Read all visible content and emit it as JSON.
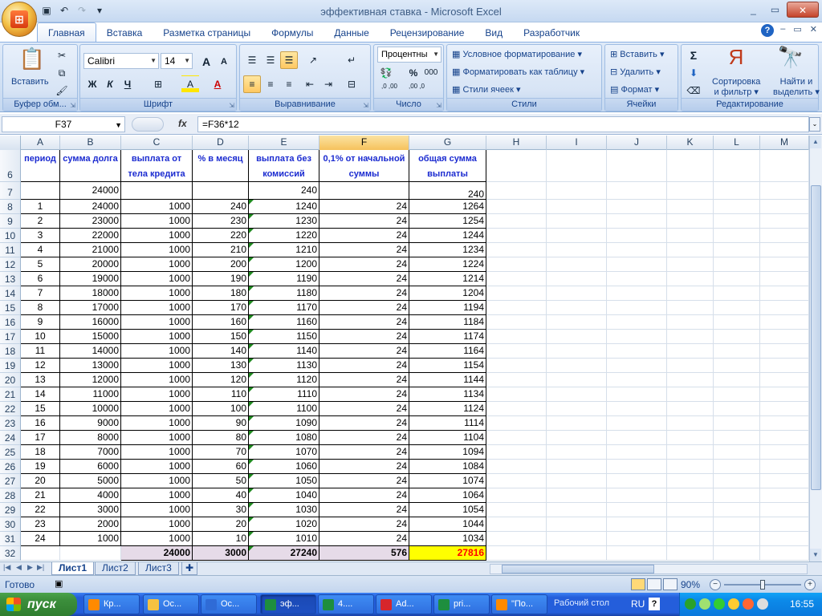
{
  "window": {
    "title": "эффективная ставка - Microsoft Excel",
    "controls": [
      "_",
      "▭",
      "✕"
    ]
  },
  "qat": {
    "icons": [
      "save-icon",
      "undo-icon",
      "redo-icon",
      "customize-icon"
    ]
  },
  "tabs": [
    "Главная",
    "Вставка",
    "Разметка страницы",
    "Формулы",
    "Данные",
    "Рецензирование",
    "Вид",
    "Разработчик"
  ],
  "active_tab": "Главная",
  "ribbon": {
    "clipboard": {
      "label": "Буфер обм...",
      "paste": "Вставить"
    },
    "font": {
      "label": "Шрифт",
      "name": "Calibri",
      "size": "14",
      "bold": "Ж",
      "italic": "К",
      "underline": "Ч",
      "grow": "A",
      "shrink": "A",
      "fill": "A",
      "color": "A"
    },
    "alignment": {
      "label": "Выравнивание"
    },
    "number": {
      "label": "Число",
      "format": "Процентны",
      "percent": "%",
      "thousands": "000",
      "inc": ",0 ,00",
      "dec": ",00 ,0"
    },
    "styles": {
      "label": "Стили",
      "conditional": "Условное форматирование",
      "table": "Форматировать как таблицу",
      "cell": "Стили ячеек"
    },
    "cells": {
      "label": "Ячейки",
      "insert": "Вставить",
      "delete": "Удалить",
      "format": "Формат"
    },
    "editing": {
      "label": "Редактирование",
      "sigma": "Σ",
      "sort1": "Сортировка",
      "sort2": "и фильтр",
      "find1": "Найти и",
      "find2": "выделить"
    }
  },
  "formula_bar": {
    "name_box": "F37",
    "fx": "fx",
    "formula": "=F36*12"
  },
  "columns": [
    "A",
    "B",
    "C",
    "D",
    "E",
    "F",
    "G",
    "H",
    "I",
    "J",
    "K",
    "L",
    "M"
  ],
  "selected_column": "F",
  "header_row": {
    "row": "6",
    "A": "период",
    "B": "сумма долга",
    "C": "выплата от тела кредита",
    "D": "% в месяц",
    "E": "выплата без комиссий",
    "F": "0,1% от начальной суммы",
    "G": "общая сумма выплаты"
  },
  "row7": {
    "row": "7",
    "B": "24000",
    "E": "240",
    "G": "240"
  },
  "data_rows": [
    {
      "row": "8",
      "A": "1",
      "B": "24000",
      "C": "1000",
      "D": "240",
      "E": "1240",
      "F": "24",
      "G": "1264"
    },
    {
      "row": "9",
      "A": "2",
      "B": "23000",
      "C": "1000",
      "D": "230",
      "E": "1230",
      "F": "24",
      "G": "1254"
    },
    {
      "row": "10",
      "A": "3",
      "B": "22000",
      "C": "1000",
      "D": "220",
      "E": "1220",
      "F": "24",
      "G": "1244"
    },
    {
      "row": "11",
      "A": "4",
      "B": "21000",
      "C": "1000",
      "D": "210",
      "E": "1210",
      "F": "24",
      "G": "1234"
    },
    {
      "row": "12",
      "A": "5",
      "B": "20000",
      "C": "1000",
      "D": "200",
      "E": "1200",
      "F": "24",
      "G": "1224"
    },
    {
      "row": "13",
      "A": "6",
      "B": "19000",
      "C": "1000",
      "D": "190",
      "E": "1190",
      "F": "24",
      "G": "1214"
    },
    {
      "row": "14",
      "A": "7",
      "B": "18000",
      "C": "1000",
      "D": "180",
      "E": "1180",
      "F": "24",
      "G": "1204"
    },
    {
      "row": "15",
      "A": "8",
      "B": "17000",
      "C": "1000",
      "D": "170",
      "E": "1170",
      "F": "24",
      "G": "1194"
    },
    {
      "row": "16",
      "A": "9",
      "B": "16000",
      "C": "1000",
      "D": "160",
      "E": "1160",
      "F": "24",
      "G": "1184"
    },
    {
      "row": "17",
      "A": "10",
      "B": "15000",
      "C": "1000",
      "D": "150",
      "E": "1150",
      "F": "24",
      "G": "1174"
    },
    {
      "row": "18",
      "A": "11",
      "B": "14000",
      "C": "1000",
      "D": "140",
      "E": "1140",
      "F": "24",
      "G": "1164"
    },
    {
      "row": "19",
      "A": "12",
      "B": "13000",
      "C": "1000",
      "D": "130",
      "E": "1130",
      "F": "24",
      "G": "1154"
    },
    {
      "row": "20",
      "A": "13",
      "B": "12000",
      "C": "1000",
      "D": "120",
      "E": "1120",
      "F": "24",
      "G": "1144"
    },
    {
      "row": "21",
      "A": "14",
      "B": "11000",
      "C": "1000",
      "D": "110",
      "E": "1110",
      "F": "24",
      "G": "1134"
    },
    {
      "row": "22",
      "A": "15",
      "B": "10000",
      "C": "1000",
      "D": "100",
      "E": "1100",
      "F": "24",
      "G": "1124"
    },
    {
      "row": "23",
      "A": "16",
      "B": "9000",
      "C": "1000",
      "D": "90",
      "E": "1090",
      "F": "24",
      "G": "1114"
    },
    {
      "row": "24",
      "A": "17",
      "B": "8000",
      "C": "1000",
      "D": "80",
      "E": "1080",
      "F": "24",
      "G": "1104"
    },
    {
      "row": "25",
      "A": "18",
      "B": "7000",
      "C": "1000",
      "D": "70",
      "E": "1070",
      "F": "24",
      "G": "1094"
    },
    {
      "row": "26",
      "A": "19",
      "B": "6000",
      "C": "1000",
      "D": "60",
      "E": "1060",
      "F": "24",
      "G": "1084"
    },
    {
      "row": "27",
      "A": "20",
      "B": "5000",
      "C": "1000",
      "D": "50",
      "E": "1050",
      "F": "24",
      "G": "1074"
    },
    {
      "row": "28",
      "A": "21",
      "B": "4000",
      "C": "1000",
      "D": "40",
      "E": "1040",
      "F": "24",
      "G": "1064"
    },
    {
      "row": "29",
      "A": "22",
      "B": "3000",
      "C": "1000",
      "D": "30",
      "E": "1030",
      "F": "24",
      "G": "1054"
    },
    {
      "row": "30",
      "A": "23",
      "B": "2000",
      "C": "1000",
      "D": "20",
      "E": "1020",
      "F": "24",
      "G": "1044"
    },
    {
      "row": "31",
      "A": "24",
      "B": "1000",
      "C": "1000",
      "D": "10",
      "E": "1010",
      "F": "24",
      "G": "1034"
    }
  ],
  "totals_row": {
    "row": "32",
    "C": "24000",
    "D": "3000",
    "E": "27240",
    "F": "576",
    "G": "27816"
  },
  "sheets": [
    "Лист1",
    "Лист2",
    "Лист3"
  ],
  "active_sheet": "Лист1",
  "status": {
    "ready": "Готово",
    "zoom": "90%",
    "zoom_fraction": 0.5
  },
  "taskbar": {
    "start": "пуск",
    "tasks": [
      "Кр...",
      "Ос...",
      "Ос...",
      "эф...",
      "4....",
      "Ad...",
      "pri...",
      "\"По..."
    ],
    "active_task": 3,
    "desktop": "Рабочий стол",
    "lang": "RU",
    "clock": "16:55"
  }
}
